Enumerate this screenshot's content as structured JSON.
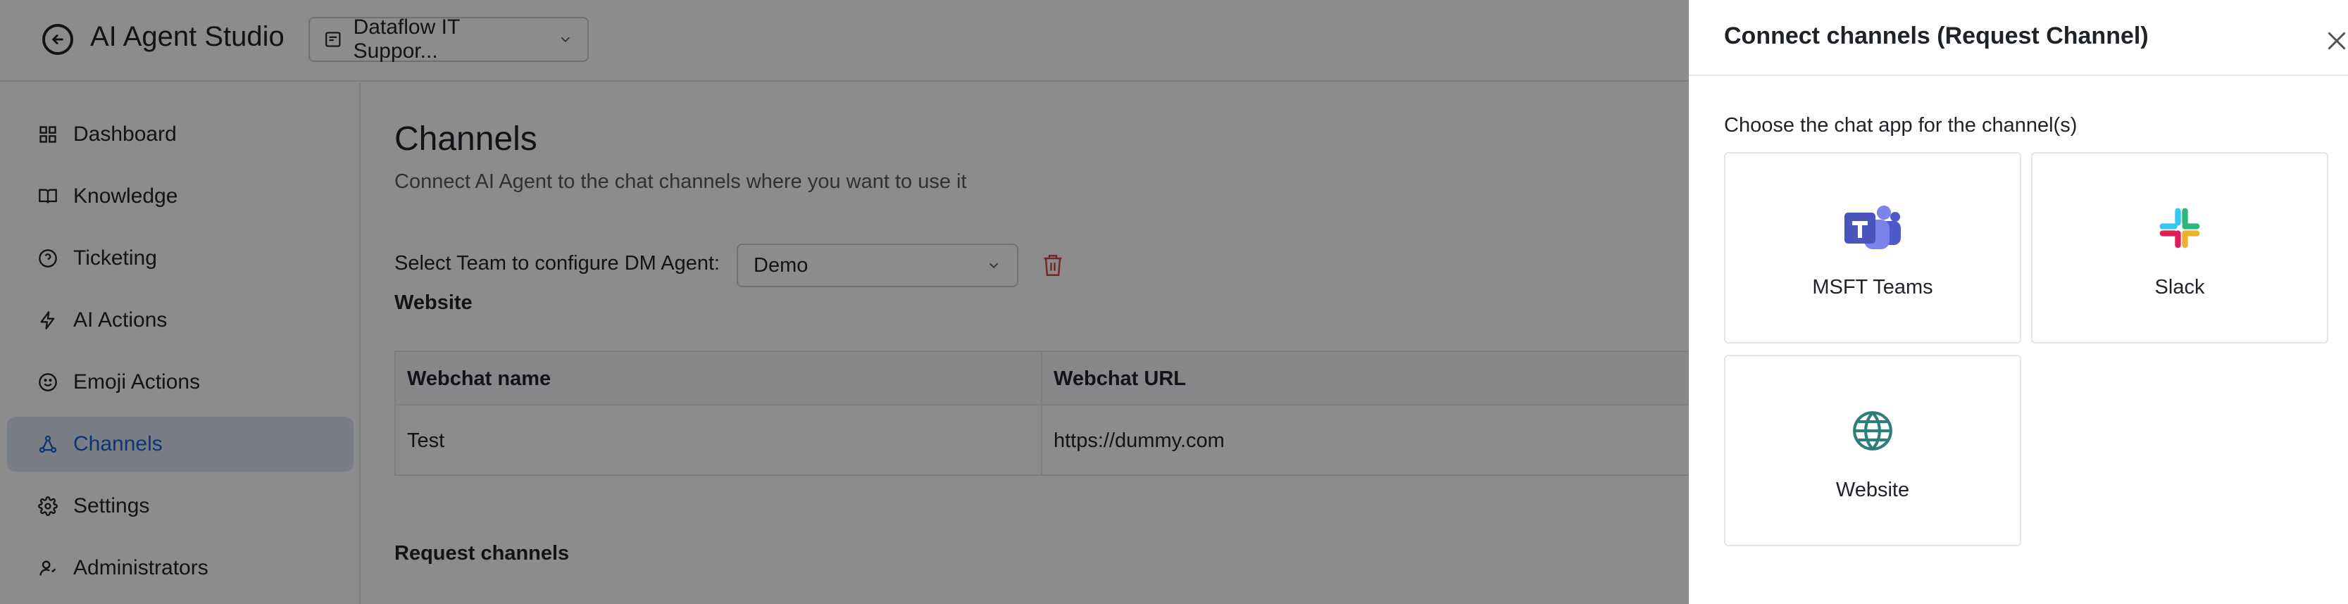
{
  "app": {
    "title": "AI Agent Studio",
    "workspace": "Dataflow IT Suppor..."
  },
  "sidebar": {
    "items": [
      {
        "label": "Dashboard",
        "icon": "grid-icon",
        "active": false
      },
      {
        "label": "Knowledge",
        "icon": "book-icon",
        "active": false
      },
      {
        "label": "Ticketing",
        "icon": "help-circle-icon",
        "active": false
      },
      {
        "label": "AI Actions",
        "icon": "lightning-icon",
        "active": false
      },
      {
        "label": "Emoji Actions",
        "icon": "smiley-icon",
        "active": false
      },
      {
        "label": "Channels",
        "icon": "network-icon",
        "active": true
      },
      {
        "label": "Settings",
        "icon": "gear-icon",
        "active": false
      },
      {
        "label": "Administrators",
        "icon": "user-admin-icon",
        "active": false
      }
    ]
  },
  "main": {
    "title": "Channels",
    "subtitle": "Connect AI Agent to the chat channels where you want to use it",
    "team_label": "Select Team to configure DM Agent:",
    "team_value": "Demo",
    "website_section": "Website",
    "table": {
      "headers": [
        "Webchat name",
        "Webchat URL"
      ],
      "rows": [
        [
          "Test",
          "https://dummy.com"
        ]
      ]
    },
    "request_section": "Request channels"
  },
  "drawer": {
    "title": "Connect channels (Request Channel)",
    "subtitle": "Choose the chat app for the channel(s)",
    "options": [
      {
        "label": "MSFT Teams",
        "icon": "msft-teams-icon"
      },
      {
        "label": "Slack",
        "icon": "slack-icon"
      },
      {
        "label": "Website",
        "icon": "globe-icon"
      }
    ]
  },
  "colors": {
    "accent": "#1a5fd0",
    "active_bg": "#dde6f5",
    "danger": "#d64545",
    "teams": "#5b5fc7",
    "globe": "#2e7d7a"
  }
}
